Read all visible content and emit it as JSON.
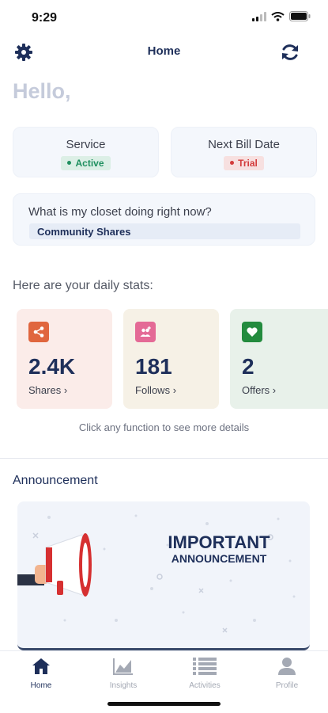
{
  "status_bar": {
    "time": "9:29"
  },
  "header": {
    "title": "Home",
    "settings_icon": "gear-icon",
    "refresh_icon": "refresh-icon"
  },
  "greeting": "Hello,",
  "service_card": {
    "label": "Service",
    "badge": "Active",
    "badge_color": "#1f8f5f"
  },
  "bill_card": {
    "label": "Next Bill Date",
    "badge": "Trial",
    "badge_color": "#d33b3b"
  },
  "closet": {
    "question": "What is my closet doing right now?",
    "status": "Community Shares"
  },
  "stats": {
    "heading": "Here are your daily stats:",
    "items": [
      {
        "value": "2.4K",
        "label": "Shares",
        "icon": "share-icon",
        "bg": "#fbece9",
        "accent": "#e0663e"
      },
      {
        "value": "181",
        "label": "Follows",
        "icon": "follow-icon",
        "bg": "#f6f1e6",
        "accent": "#e46a96"
      },
      {
        "value": "2",
        "label": "Offers",
        "icon": "heart-icon",
        "bg": "#e8f1ea",
        "accent": "#238b3e"
      }
    ],
    "hint": "Click any function to see more details"
  },
  "announcement": {
    "heading": "Announcement",
    "banner_title": "IMPORTANT",
    "banner_subtitle": "ANNOUNCEMENT"
  },
  "tabs": [
    {
      "label": "Home",
      "icon": "home-icon",
      "active": true
    },
    {
      "label": "Insights",
      "icon": "chart-icon",
      "active": false
    },
    {
      "label": "Activities",
      "icon": "list-icon",
      "active": false
    },
    {
      "label": "Profile",
      "icon": "person-icon",
      "active": false
    }
  ]
}
